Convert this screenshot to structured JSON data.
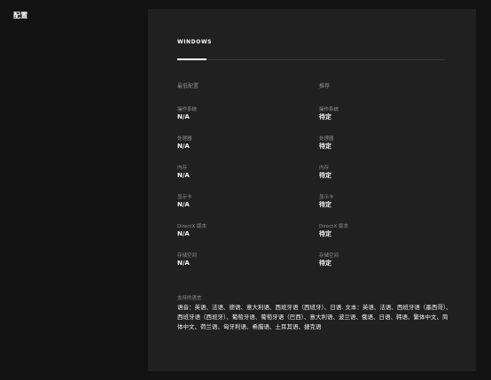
{
  "page": {
    "title": "配置"
  },
  "tab": {
    "label": "WINDOWS"
  },
  "minimum": {
    "heading": "最低配置",
    "specs": [
      {
        "label": "操作系统",
        "value": "N/A"
      },
      {
        "label": "处理器",
        "value": "N/A"
      },
      {
        "label": "内存",
        "value": "N/A"
      },
      {
        "label": "显示卡",
        "value": "N/A"
      },
      {
        "label": "DirectX 版本",
        "value": "N/A"
      },
      {
        "label": "存储空间",
        "value": "N/A"
      }
    ]
  },
  "recommended": {
    "heading": "推荐",
    "specs": [
      {
        "label": "操作系统",
        "value": "待定"
      },
      {
        "label": "处理器",
        "value": "待定"
      },
      {
        "label": "内存",
        "value": "待定"
      },
      {
        "label": "显示卡",
        "value": "待定"
      },
      {
        "label": "DirectX 版本",
        "value": "待定"
      },
      {
        "label": "存储空间",
        "value": "待定"
      }
    ]
  },
  "languages": {
    "label": "支持的语言",
    "text": "语音：英语、法语、德语、意大利语、西班牙语（西班牙）、日语. 文本：英语、法语、西班牙语（墨西哥）、西班牙语（西班牙）、葡萄牙语、葡萄牙语（巴西）、意大利语、波兰语、俄语、日语、韩语、繁体中文、简体中文、荷兰语、匈牙利语、希腊语、土耳其语、捷克语"
  }
}
